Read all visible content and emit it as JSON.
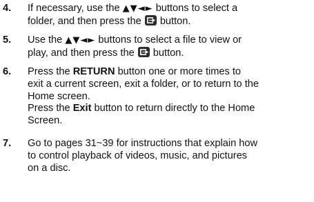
{
  "steps": [
    {
      "number": "4.",
      "lines": [
        {
          "pre": "If necessary, use the ",
          "arrows": "▲▼◄►",
          "post": " buttons to select a"
        },
        {
          "pre": "folder, and then press the ",
          "icon": "enter-icon",
          "post": " button."
        }
      ]
    },
    {
      "number": "5.",
      "lines": [
        {
          "pre": "Use the ",
          "arrows": "▲▼◄►",
          "post": " buttons to select a file to view or"
        },
        {
          "pre": "play, and then press the ",
          "icon": "enter-icon",
          "post": " button."
        }
      ]
    },
    {
      "number": "6.",
      "lines": [
        {
          "pre": "Press the ",
          "bold": "RETURN",
          "post": " button one or more times to"
        },
        {
          "pre": "exit a current screen, exit a folder, or to return to the"
        },
        {
          "pre": "Home screen."
        },
        {
          "pre": "Press the ",
          "bold": "Exit",
          "post": " button to return directly to the Home"
        },
        {
          "pre": "Screen."
        }
      ]
    },
    {
      "number": "7.",
      "lines": [
        {
          "pre": "Go to pages 31~39 for instructions that explain how"
        },
        {
          "pre": "to control playback of videos, music, and pictures"
        },
        {
          "pre": "on a disc."
        }
      ]
    }
  ],
  "icon_color": "#2e2e2e"
}
